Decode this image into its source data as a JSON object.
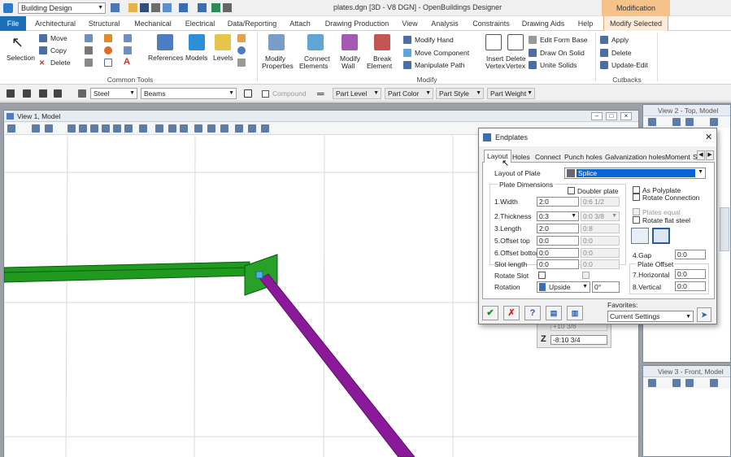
{
  "titlebar": {
    "workspace": "Building Design",
    "title": "plates.dgn [3D - V8 DGN] - OpenBuildings Designer",
    "context_tab_group": "Modification"
  },
  "tabs": [
    "File",
    "Architectural",
    "Structural",
    "Mechanical",
    "Electrical",
    "Data/Reporting",
    "Attach",
    "Drawing Production",
    "View",
    "Analysis",
    "Constraints",
    "Drawing Aids",
    "Help",
    "Modify Selected"
  ],
  "ribbon": {
    "common_tools": {
      "label": "Common Tools",
      "selection": "Selection",
      "move": "Move",
      "copy": "Copy",
      "delete": "Delete",
      "references": "References",
      "models": "Models",
      "levels": "Levels"
    },
    "modify": {
      "label": "Modify",
      "modify_properties_1": "Modify",
      "modify_properties_2": "Properties",
      "connect_elements_1": "Connect",
      "connect_elements_2": "Elements",
      "modify_wall_1": "Modify",
      "modify_wall_2": "Wall",
      "break_element_1": "Break",
      "break_element_2": "Element",
      "modify_hand": "Modify Hand",
      "move_component": "Move Component",
      "manipulate_path": "Manipulate Path",
      "insert_vertex_1": "Insert",
      "insert_vertex_2": "Vertex",
      "delete_vertex_1": "Delete",
      "delete_vertex_2": "Vertex",
      "edit_form_base": "Edit Form Base",
      "draw_on_solid": "Draw On Solid",
      "unite_solids": "Unite Solids"
    },
    "cutbacks": {
      "label": "Cutbacks",
      "apply": "Apply",
      "delete": "Delete",
      "update_edit": "Update-Edit"
    }
  },
  "toolbar": {
    "material": "Steel",
    "type": "Beams",
    "compound": "Compound",
    "part_level": "Part Level",
    "part_color": "Part Color",
    "part_style": "Part Style",
    "part_weight": "Part Weight"
  },
  "views": {
    "view1": "View 1, Model",
    "view2": "View 2 - Top, Model",
    "view3": "View 3 - Front, Model"
  },
  "coord_panel": {
    "value1": "+10 3/8",
    "z_label": "Z",
    "z_value": "-8:10 3/4"
  },
  "dialog": {
    "title": "Endplates",
    "tabs": [
      "Layout",
      "Holes",
      "Connect",
      "Punch holes",
      "Galvanization holes",
      "Moment",
      "S"
    ],
    "layout_of_plate_label": "Layout of Plate",
    "layout_of_plate_value": "Splice",
    "plate_dimensions_label": "Plate Dimensions",
    "doubler_plate": "Doubler plate",
    "as_polyplate": "As Polyplate",
    "rotate_connection": "Rotate Connection",
    "plates_equal": "Plates equal",
    "rotate_flat_steel": "Rotate flat steel",
    "fields": [
      {
        "label": "1.Width",
        "value": "2:0",
        "secondary": "0:6 1/2"
      },
      {
        "label": "2.Thickness",
        "value": "0:3",
        "secondary": "0:0 3/8"
      },
      {
        "label": "3.Length",
        "value": "2:0",
        "secondary": "0:8"
      },
      {
        "label": "5.Offset top",
        "value": "0:0",
        "secondary": "0:0"
      },
      {
        "label": "6.Offset bottom",
        "value": "0:0",
        "secondary": "0:0"
      },
      {
        "label": "Slot length",
        "value": "0:0",
        "secondary": "0:0"
      }
    ],
    "rotate_slot": "Rotate Slot",
    "rotation_label": "Rotation",
    "rotation_value": "Upside",
    "rotation_angle": "0°",
    "gap_label": "4.Gap",
    "gap_value": "0:0",
    "plate_offset_label": "Plate Offset",
    "horizontal_label": "7.Horizontal",
    "horizontal_value": "0:0",
    "vertical_label": "8.Vertical",
    "vertical_value": "0:0",
    "favorites_label": "Favorites:",
    "favorites_value": "Current Settings"
  },
  "colors": {
    "file_tab": "#1b6fb7",
    "context_tab": "#f5c28a",
    "beam": "#1f9a1f",
    "brace": "#8a1a9a"
  }
}
